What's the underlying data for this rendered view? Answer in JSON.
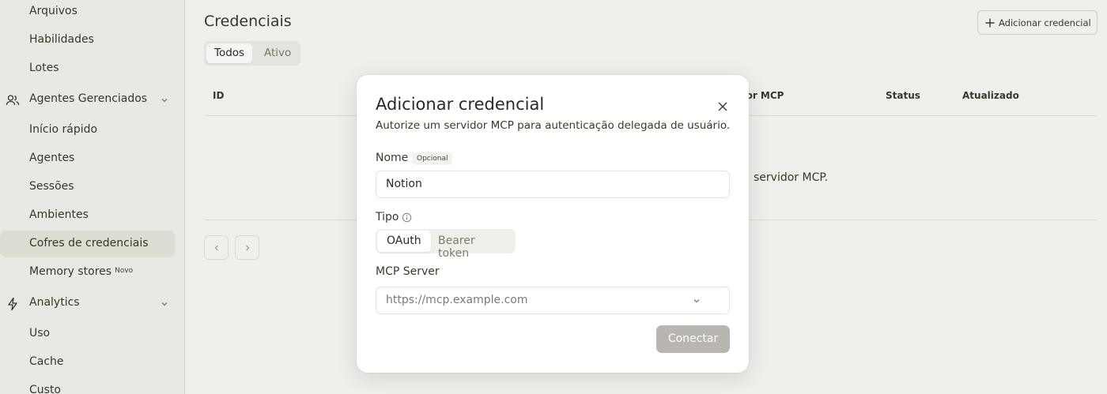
{
  "sidebar": {
    "items_top": [
      "Arquivos",
      "Habilidades",
      "Lotes"
    ],
    "section_agents": {
      "label": "Agentes Gerenciados",
      "icon": "users-icon"
    },
    "items_agents": [
      "Início rápido",
      "Agentes",
      "Sessões",
      "Ambientes",
      "Cofres de credenciais",
      "Memory stores"
    ],
    "memory_badge": "Novo",
    "section_analytics": {
      "label": "Analytics",
      "icon": "activity-icon"
    },
    "items_analytics": [
      "Uso",
      "Cache",
      "Custo"
    ]
  },
  "main": {
    "title": "Credenciais",
    "add_button": "Adicionar credencial",
    "filters": [
      "Todos",
      "Ativo"
    ],
    "columns": [
      "ID",
      "dor MCP",
      "Status",
      "Atualizado"
    ],
    "empty_message_tail": "servidor MCP."
  },
  "modal": {
    "title": "Adicionar credencial",
    "subtitle": "Autorize um servidor MCP para autenticação delegada de usuário.",
    "name_label": "Nome",
    "name_badge": "Opcional",
    "name_value": "Notion",
    "type_label": "Tipo",
    "type_options": [
      "OAuth",
      "Bearer token"
    ],
    "type_selected": "OAuth",
    "server_label": "MCP Server",
    "server_placeholder": "https://mcp.example.com",
    "connect_button": "Conectar"
  },
  "colors": {
    "sidebar_bg": "#f3f2ee",
    "main_bg": "#faf9f5",
    "active_item_bg": "#e8e6dd",
    "disabled_button": "#b8b6af",
    "text": "#3d3929"
  }
}
